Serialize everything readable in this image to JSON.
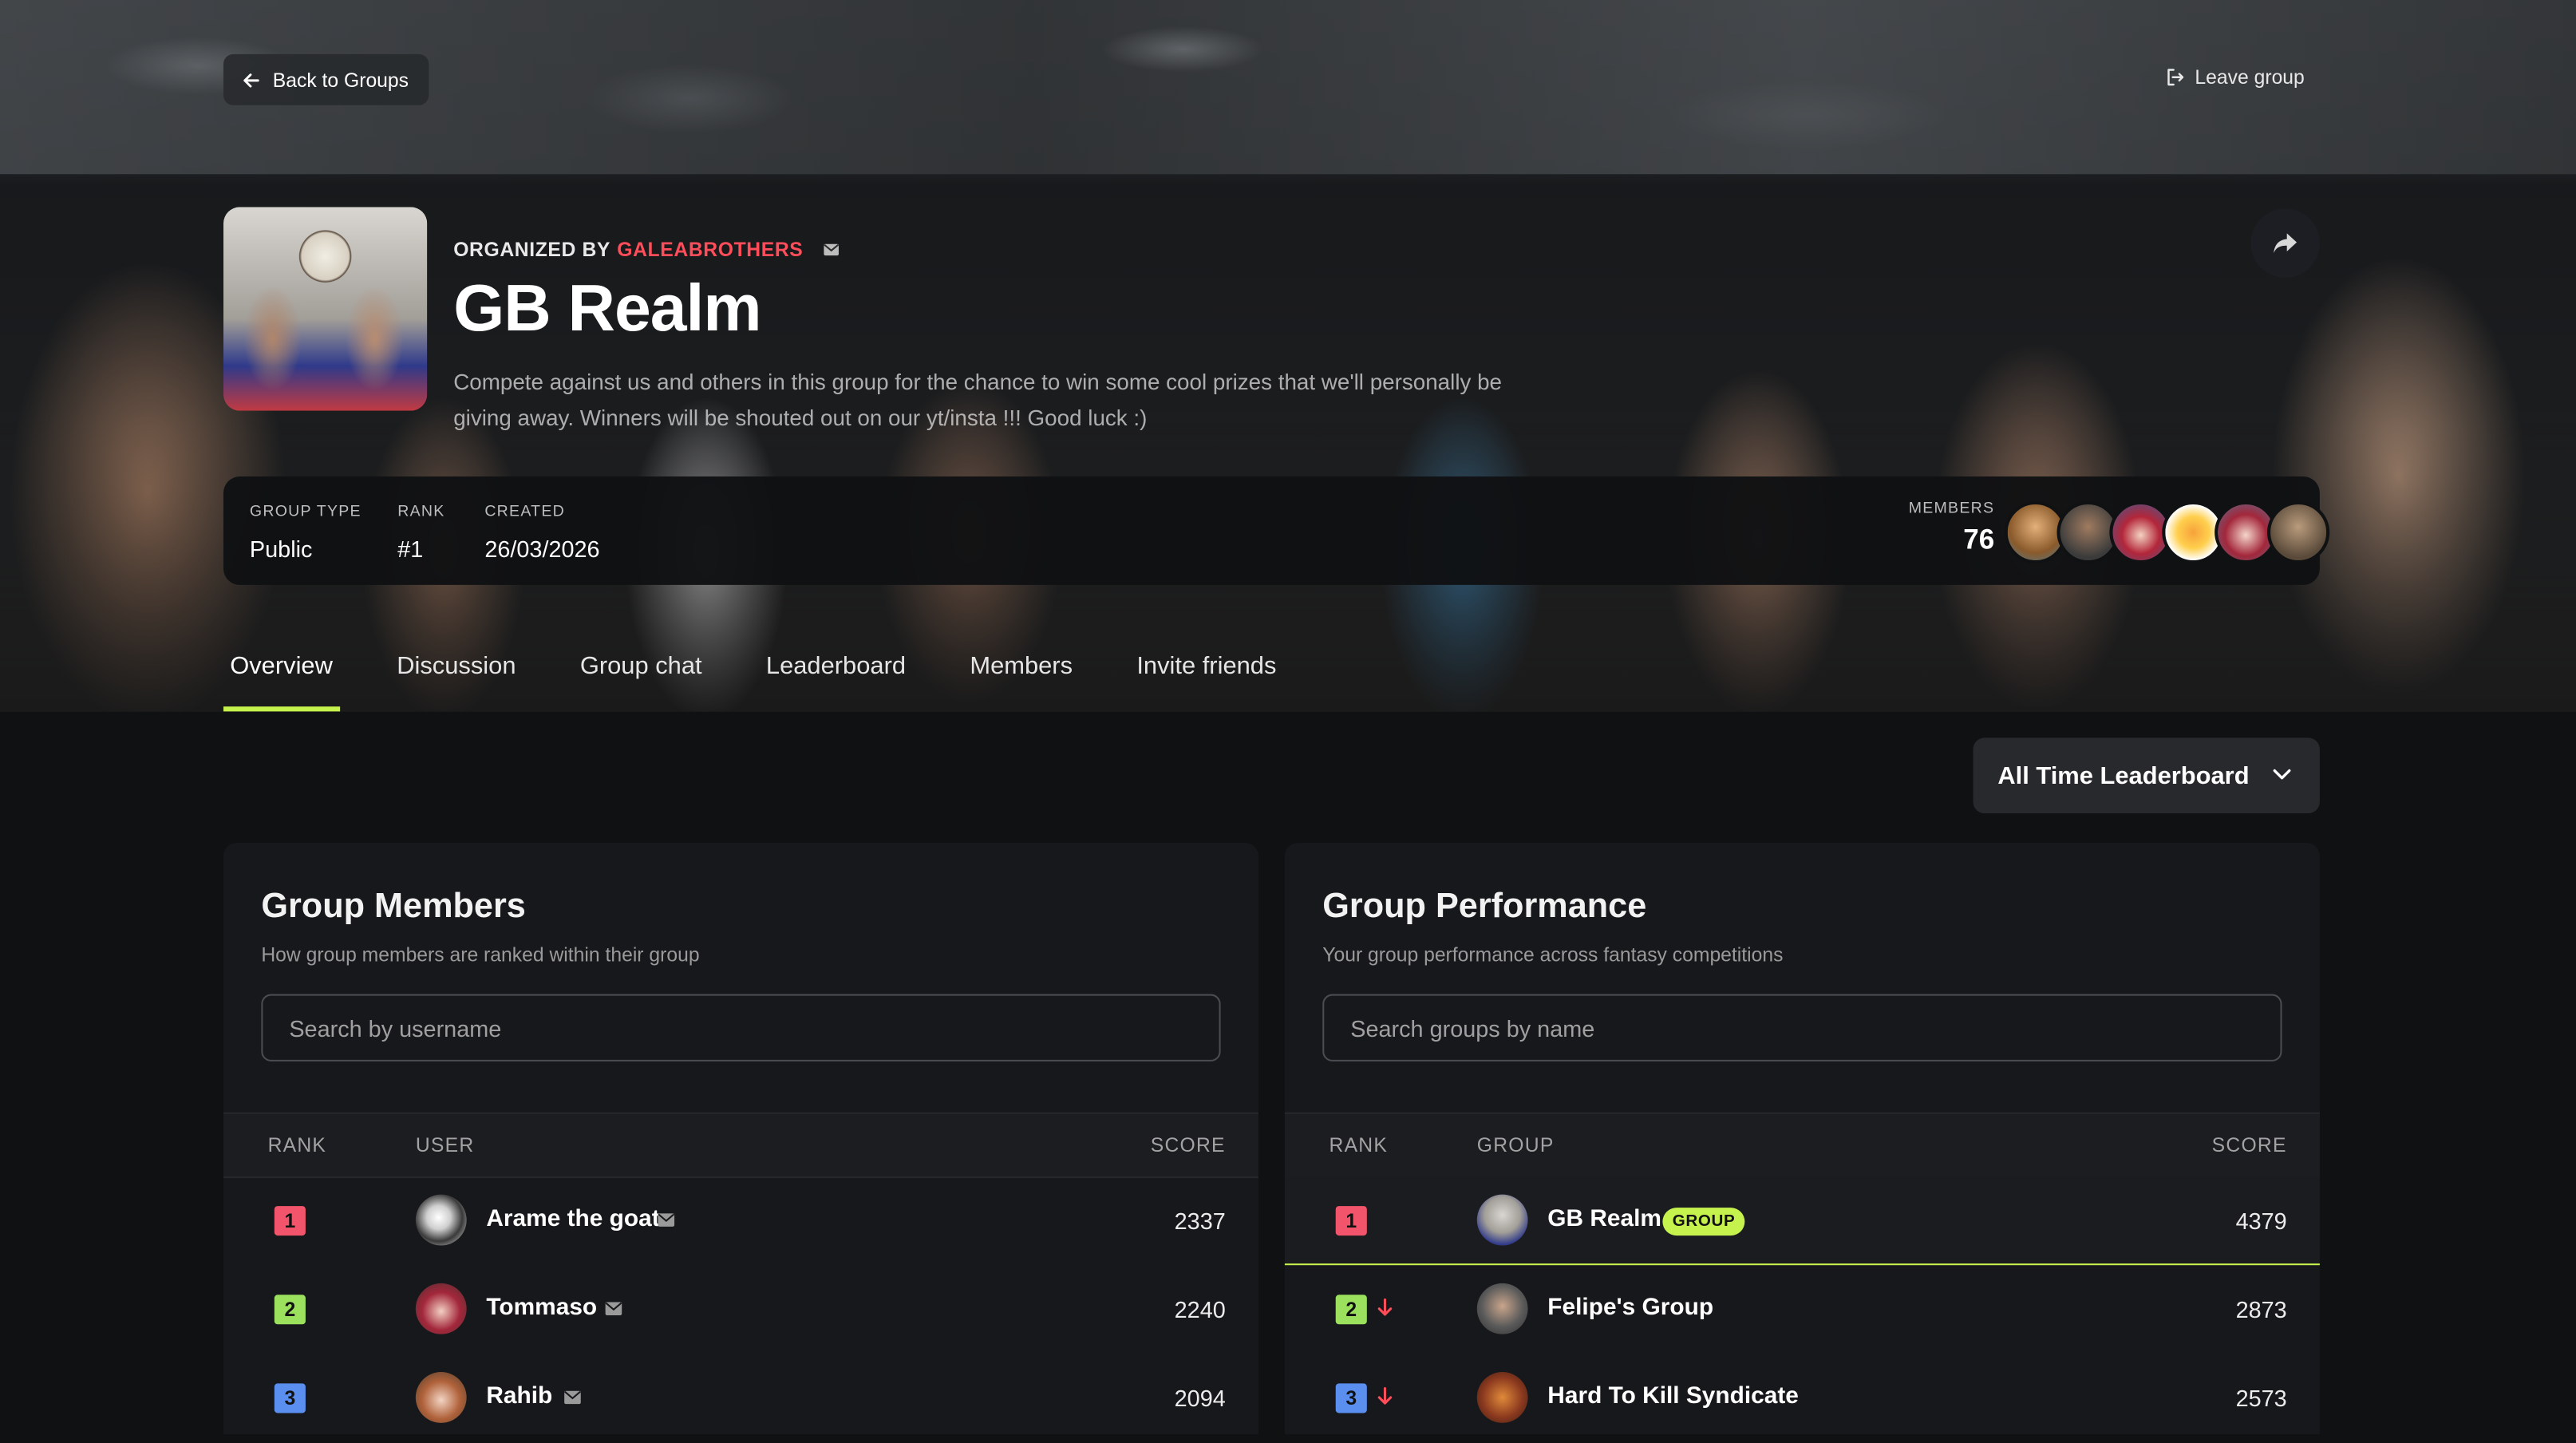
{
  "nav": {
    "back_label": "Back to Groups",
    "leave_label": "Leave group"
  },
  "group": {
    "organized_prefix": "ORGANIZED BY",
    "organizer": "GALEABROTHERS",
    "title": "GB Realm",
    "description": "Compete against us and others in this group for the chance to win some cool prizes that we'll personally be giving away. Winners will be shouted out on our yt/insta !!! Good luck :)"
  },
  "info": {
    "type_label": "GROUP TYPE",
    "type_value": "Public",
    "rank_label": "RANK",
    "rank_value": "#1",
    "created_label": "CREATED",
    "created_value": "26/03/2026",
    "members_label": "MEMBERS",
    "members_value": "76"
  },
  "tabs": [
    {
      "label": "Overview",
      "active": true
    },
    {
      "label": "Discussion"
    },
    {
      "label": "Group chat"
    },
    {
      "label": "Leaderboard"
    },
    {
      "label": "Members"
    },
    {
      "label": "Invite friends"
    }
  ],
  "leaderboard_select": {
    "value": "All Time Leaderboard"
  },
  "members_panel": {
    "title": "Group Members",
    "subtitle": "How group members are ranked within their group",
    "search_placeholder": "Search by username",
    "columns": {
      "rank": "RANK",
      "user": "USER",
      "score": "SCORE"
    },
    "rows": [
      {
        "rank": "1",
        "name": "Arame the goat",
        "score": "2337"
      },
      {
        "rank": "2",
        "name": "Tommaso",
        "score": "2240"
      },
      {
        "rank": "3",
        "name": "Rahib",
        "score": "2094"
      }
    ]
  },
  "performance_panel": {
    "title": "Group Performance",
    "subtitle": "Your group performance across fantasy competitions",
    "search_placeholder": "Search groups by name",
    "columns": {
      "rank": "RANK",
      "group": "GROUP",
      "score": "SCORE"
    },
    "rows": [
      {
        "rank": "1",
        "name": "GB Realm",
        "badge": "GROUP",
        "score": "4379"
      },
      {
        "rank": "2",
        "name": "Felipe's Group",
        "score": "2873",
        "trend": "down"
      },
      {
        "rank": "3",
        "name": "Hard To Kill Syndicate",
        "score": "2573",
        "trend": "down"
      }
    ]
  },
  "colors": {
    "accent": "#c6f24e",
    "brand_red": "#ff4d5a",
    "rank1": "#f2556b",
    "rank2": "#9be15d",
    "rank3": "#5a8ff0",
    "trend_down": "#ff4d5a"
  },
  "icons": {
    "back": "arrow-left-icon",
    "leave": "exit-icon",
    "share": "share-arrow-icon",
    "mail": "mail-icon",
    "chevron": "chevron-down-icon",
    "trend_down": "arrow-down-icon"
  }
}
